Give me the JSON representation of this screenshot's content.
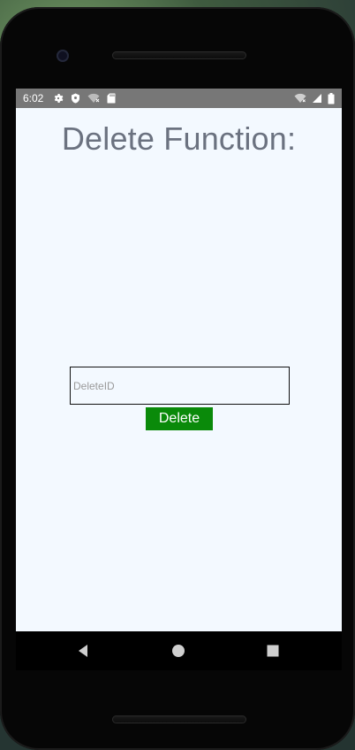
{
  "statusbar": {
    "time": "6:02",
    "left_icons": [
      "settings-icon",
      "shield-icon",
      "wifi-off-icon",
      "sd-card-icon"
    ],
    "right_icons": [
      "wifi-icon",
      "signal-icon",
      "battery-icon"
    ]
  },
  "screen": {
    "title": "Delete Function:",
    "input": {
      "value": "",
      "placeholder": "DeleteID"
    },
    "button_label": "Delete"
  },
  "navbar": {
    "items": [
      "back-icon",
      "home-icon",
      "recents-icon"
    ]
  },
  "colors": {
    "screen_bg": "#f3f9ff",
    "statusbar_bg": "#777777",
    "title_text": "#6b7280",
    "button_bg": "#0a8a0a",
    "button_text": "#ffffff"
  }
}
